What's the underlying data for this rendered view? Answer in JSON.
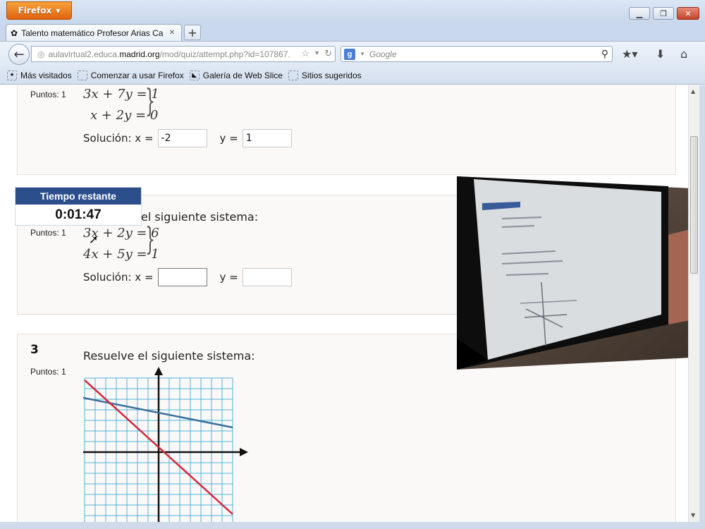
{
  "browser": {
    "menu_label": "Firefox",
    "tab_title": "Talento matemático Profesor Arias Cabe...",
    "url_gray_prefix": "aulavirtual2.educa.",
    "url_domain": "madrid.org",
    "url_path": "/mod/quiz/attempt.php?id=107867.",
    "search_engine": "Google",
    "bookmarks": [
      "Más visitados",
      "Comenzar a usar Firefox",
      "Galería de Web Slice",
      "Sitios sugeridos"
    ]
  },
  "timer": {
    "title": "Tiempo restante",
    "value": "0:01:47"
  },
  "questions": [
    {
      "points": "Puntos: 1",
      "equations": [
        "3x + 7y = 1",
        "x + 2y = 0"
      ],
      "solution_label": "Solución: x =",
      "x_value": "-2",
      "y_label": "y =",
      "y_value": "1"
    },
    {
      "statement_fragment": "el siguiente sistema:",
      "points": "Puntos: 1",
      "equations": [
        "3x + 2y = 6",
        "4x + 5y = 1"
      ],
      "solution_label": "Solución: x =",
      "x_value": "",
      "y_label": "y =",
      "y_value": ""
    },
    {
      "number": "3",
      "points": "Puntos: 1",
      "statement": "Resuelve el siguiente sistema:"
    }
  ],
  "colors": {
    "timer_header": "#2c4f8c",
    "grid_lines": "#4fb4d6",
    "line_blue": "#3a6f9a",
    "line_red": "#d6263a"
  }
}
